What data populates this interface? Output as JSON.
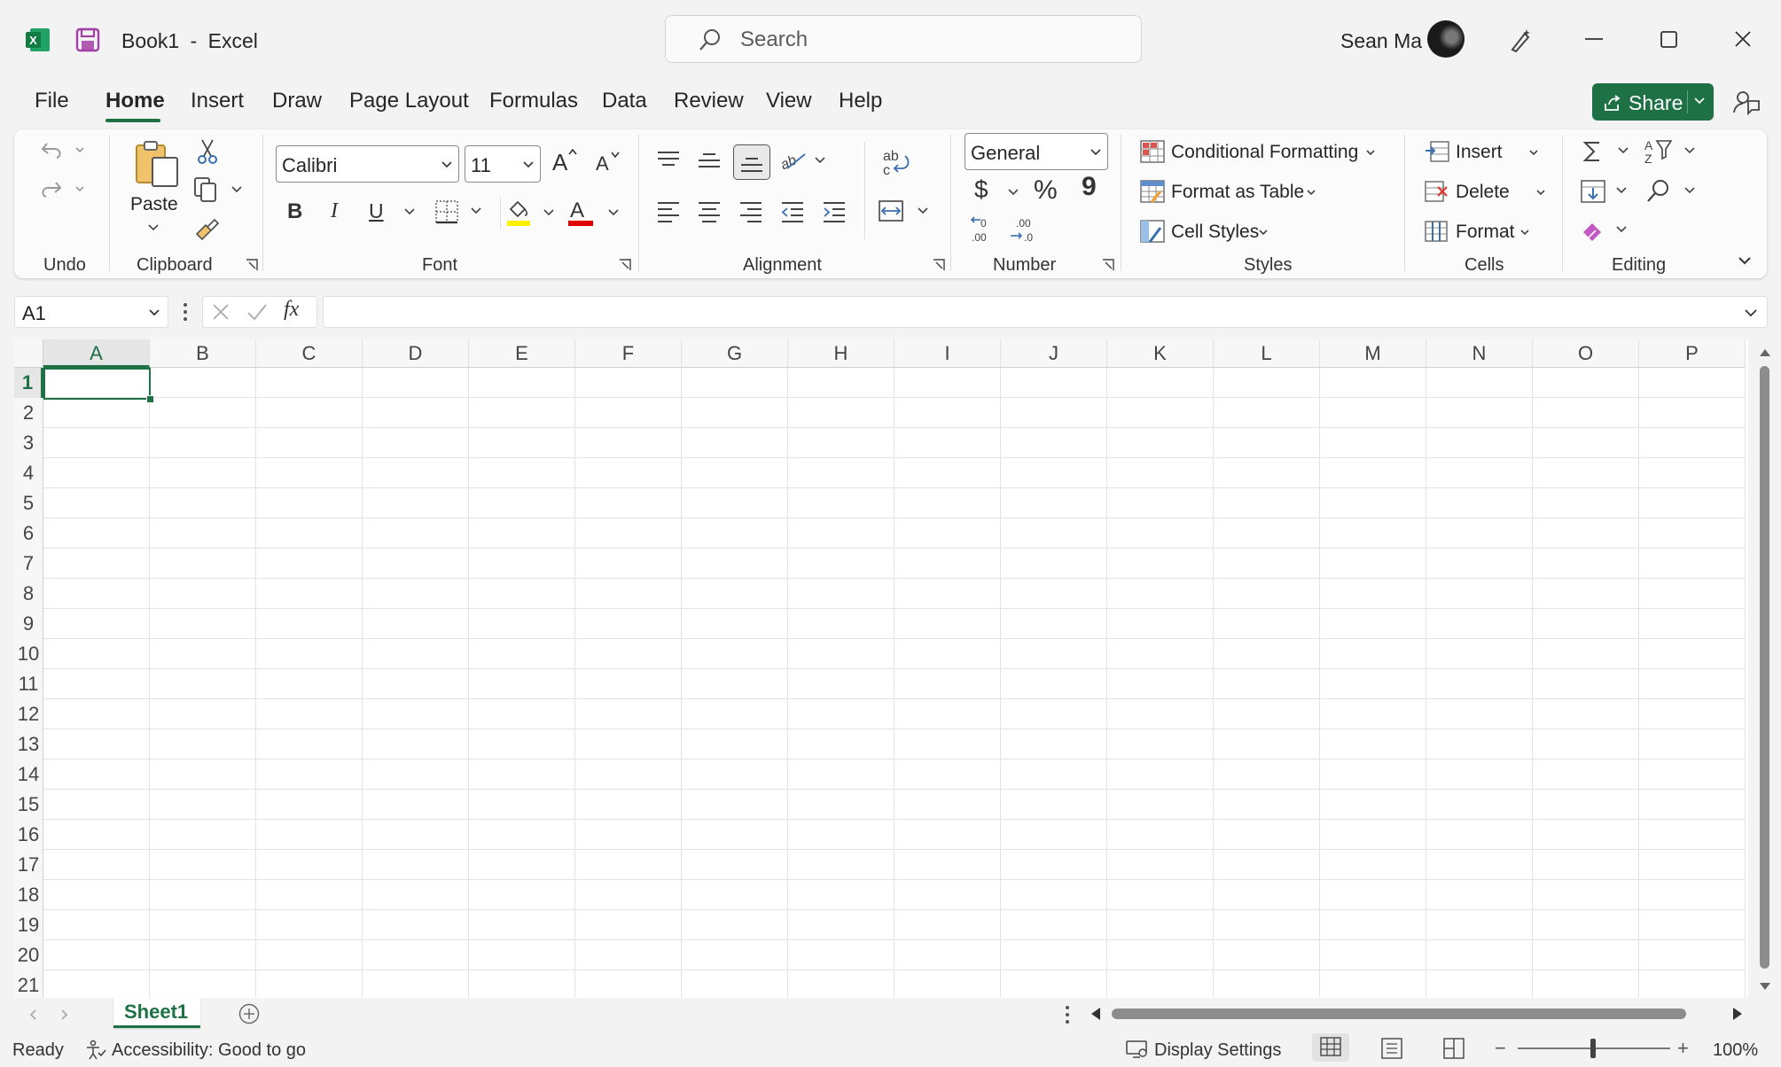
{
  "titlebar": {
    "doc_name": "Book1",
    "separator": "-",
    "app_name": "Excel",
    "search_placeholder": "Search",
    "user_name": "Sean Ma"
  },
  "menu": {
    "tabs": [
      "File",
      "Home",
      "Insert",
      "Draw",
      "Page Layout",
      "Formulas",
      "Data",
      "Review",
      "View",
      "Help"
    ],
    "active_tab": "Home",
    "share_label": "Share"
  },
  "ribbon": {
    "groups": {
      "undo": "Undo",
      "clipboard": "Clipboard",
      "font": "Font",
      "alignment": "Alignment",
      "number": "Number",
      "styles": "Styles",
      "cells": "Cells",
      "editing": "Editing"
    },
    "paste_label": "Paste",
    "font_name": "Calibri",
    "font_size": "11",
    "number_format": "General",
    "conditional_formatting": "Conditional Formatting",
    "format_as_table": "Format as Table",
    "cell_styles": "Cell Styles",
    "insert": "Insert",
    "delete": "Delete",
    "format": "Format",
    "bold": "B",
    "italic": "I",
    "underline": "U",
    "currency": "$",
    "percent": "%",
    "comma": "9"
  },
  "formula_bar": {
    "name_box": "A1",
    "fx_label": "fx",
    "formula_value": ""
  },
  "sheet": {
    "columns": [
      "A",
      "B",
      "C",
      "D",
      "E",
      "F",
      "G",
      "H",
      "I",
      "J",
      "K",
      "L",
      "M",
      "N",
      "O",
      "P"
    ],
    "rows": [
      "1",
      "2",
      "3",
      "4",
      "5",
      "6",
      "7",
      "8",
      "9",
      "10",
      "11",
      "12",
      "13",
      "14",
      "15",
      "16",
      "17",
      "18",
      "19",
      "20",
      "21"
    ],
    "selected_cell": "A1",
    "tabs": [
      "Sheet1"
    ],
    "active_tab": "Sheet1"
  },
  "status": {
    "ready": "Ready",
    "accessibility": "Accessibility: Good to go",
    "display_settings": "Display Settings",
    "zoom": "100%",
    "minus": "−",
    "plus": "+"
  },
  "colors": {
    "accent_green": "#1e7145",
    "excel_icon": "#107c41",
    "save_icon": "#a23ea7",
    "font_color_bar": "#e00000",
    "highlight_bar": "#ffee00"
  },
  "icons": [
    "excel-icon",
    "save-icon",
    "search-icon",
    "avatar",
    "designer-icon",
    "minimize-icon",
    "maximize-icon",
    "close-icon",
    "comments-icon",
    "undo-icon",
    "redo-icon",
    "cut-icon",
    "copy-icon",
    "format-painter-icon",
    "grow-font-icon",
    "shrink-font-icon",
    "borders-icon",
    "fill-color-icon",
    "font-color-icon",
    "sum-icon",
    "sort-filter-icon",
    "find-icon",
    "fill-icon",
    "clear-icon"
  ]
}
